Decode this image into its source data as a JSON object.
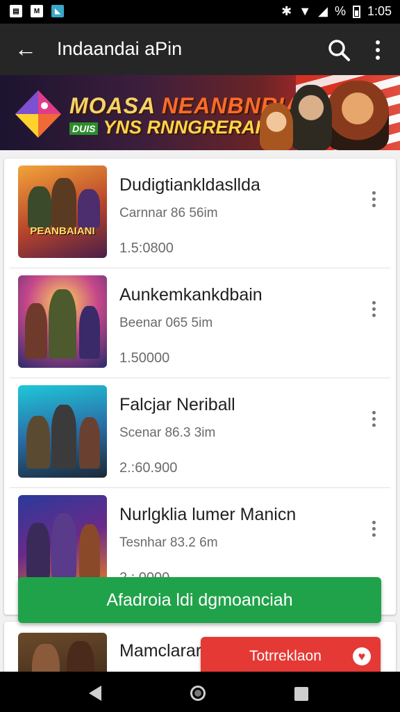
{
  "status_bar": {
    "percent": "%",
    "time": "1:05"
  },
  "app_bar": {
    "title": "Indaandai aPin"
  },
  "banner": {
    "line1_a": "MOASA",
    "line1_b": "NEANBNRIAN",
    "line2": "YNS RNNGRERAIS",
    "badge": "DUIS"
  },
  "games": [
    {
      "name": "Dudigtiankldasllda",
      "sub": "Carnnar 86 56im",
      "count": "1.5:0800",
      "art": "PEANBAIANI"
    },
    {
      "name": "Aunkemkankdbain",
      "sub": "Beenar 065 5im",
      "count": "1.50000",
      "art": ""
    },
    {
      "name": "Falcjar Neriball",
      "sub": "Scenar 86.3 3im",
      "count": "2.:60.900",
      "art": ""
    },
    {
      "name": "Nurlgklia lumer Manicn",
      "sub": "Tesnhar 83.2 6m",
      "count": "2.: 0000",
      "art": ""
    },
    {
      "name": "Mamclarar",
      "sub": "",
      "count": "",
      "art": ""
    }
  ],
  "actions": {
    "primary": "Afadroia ldi dgmoanciah",
    "secondary": "Totrreklaon"
  },
  "colors": {
    "appbar": "#262626",
    "primary": "#20a24a",
    "secondary": "#e53935"
  }
}
